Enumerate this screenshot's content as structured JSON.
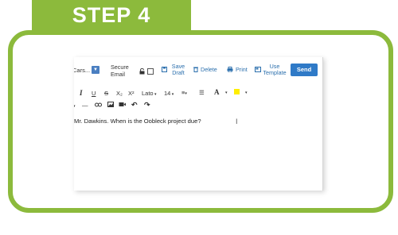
{
  "banner": {
    "step_label": "STEP 4"
  },
  "toolbar": {
    "from_select": "Cars...",
    "from_arrow": "▼",
    "secure_label_line1": "Secure",
    "secure_label_line2": "Email",
    "save_draft_line1": "Save",
    "save_draft_line2": "Draft",
    "delete_label": "Delete",
    "print_label": "Print",
    "use_template_line1": "Use",
    "use_template_line2": "Template",
    "send_label": "Send"
  },
  "format_bar": {
    "italic": "I",
    "underline": "U",
    "strike": "S",
    "subscript": "X₂",
    "superscript": "X²",
    "font_name": "Lato",
    "font_size": "14",
    "text_color": "A",
    "highlight_color": "#ffee00"
  },
  "editor": {
    "body_text": "Mr. Dawkins. When is the Oobleck project due?"
  },
  "colors": {
    "brand_green": "#8cba3c",
    "link_blue": "#2b6fad",
    "send_blue": "#2f7ac7"
  }
}
